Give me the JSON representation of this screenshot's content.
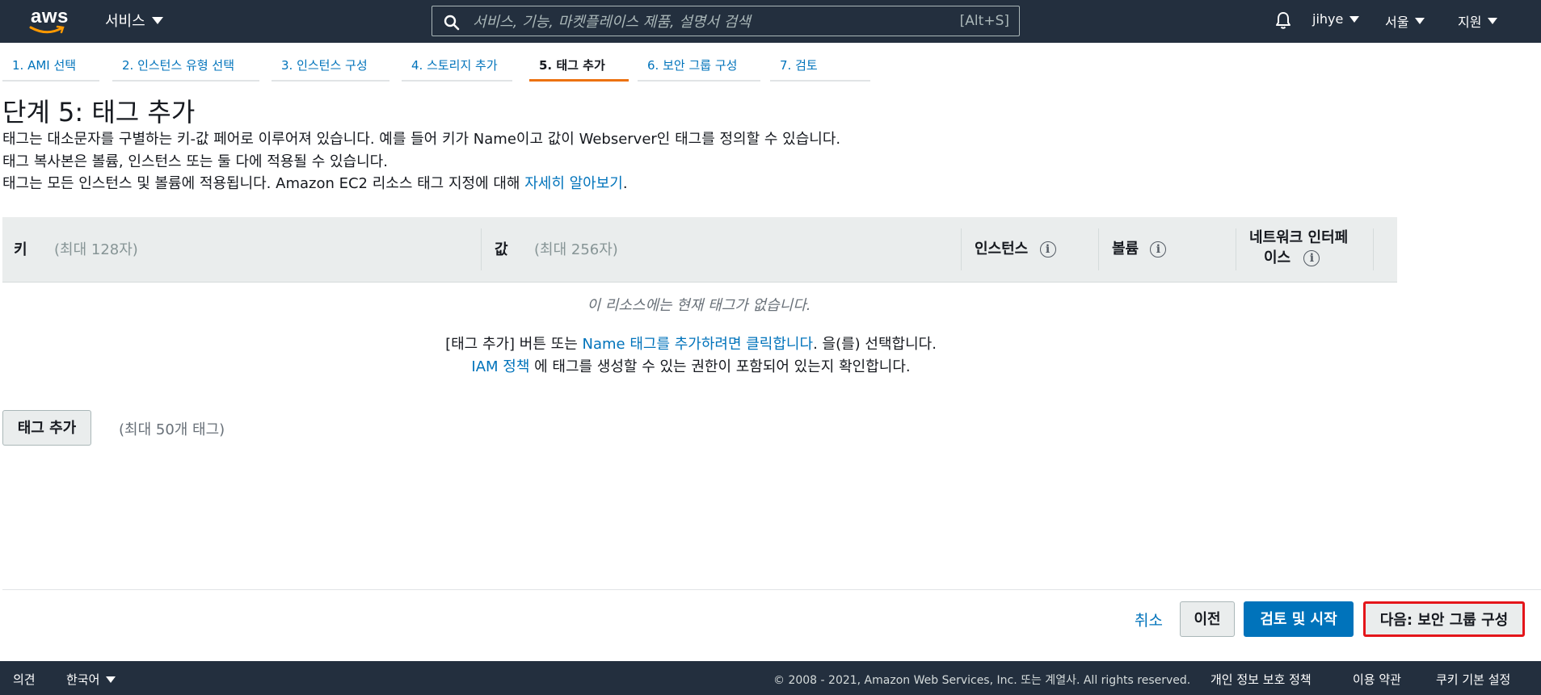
{
  "header": {
    "logo_text": "aws",
    "services_label": "서비스",
    "search_placeholder": "서비스, 기능, 마켓플레이스 제품, 설명서 검색",
    "search_shortcut": "[Alt+S]",
    "user_label": "jihye",
    "region_label": "서울",
    "support_label": "지원"
  },
  "wizard": {
    "steps": [
      {
        "label": "1. AMI 선택"
      },
      {
        "label": "2. 인스턴스 유형 선택"
      },
      {
        "label": "3. 인스턴스 구성"
      },
      {
        "label": "4. 스토리지 추가"
      },
      {
        "label": "5. 태그 추가"
      },
      {
        "label": "6. 보안 그룹 구성"
      },
      {
        "label": "7. 검토"
      }
    ],
    "active_step": 5
  },
  "page": {
    "title": "단계 5: 태그 추가",
    "desc1": "태그는 대소문자를 구별하는 키-값 페어로 이루어져 있습니다. 예를 들어 키가 Name이고 값이 Webserver인 태그를 정의할 수 있습니다.",
    "desc2": "태그 복사본은 볼륨, 인스턴스 또는 둘 다에 적용될 수 있습니다.",
    "desc3": "태그는 모든 인스턴스 및 볼륨에 적용됩니다. Amazon EC2 리소스 태그 지정에 대해 ",
    "learn_more_link": "자세히 알아보기",
    "desc3_end": "."
  },
  "table": {
    "key_header": "키",
    "key_hint": "(최대 128자)",
    "value_header": "값",
    "value_hint": "(최대 256자)",
    "instances_header": "인스턴스",
    "volumes_header": "볼륨",
    "network_header_line1": "네트워크 인터페",
    "network_header_line2": "이스",
    "info_glyph": "i",
    "empty_message": "이 리소스에는 현재 태그가 없습니다.",
    "msg1_prefix": "[태그 추가] 버튼 또는 ",
    "msg1_link": "Name 태그를 추가하려면 클릭합니다",
    "msg1_suffix": ". 을(를) 선택합니다.",
    "msg2_link": "IAM 정책",
    "msg2_suffix": " 에 태그를 생성할 수 있는 권한이 포함되어 있는지 확인합니다."
  },
  "actions": {
    "add_tag_label": "태그 추가",
    "max_tags_label": "(최대 50개 태그)",
    "cancel_label": "취소",
    "previous_label": "이전",
    "review_launch_label": "검토 및 시작",
    "next_label": "다음: 보안 그룹 구성"
  },
  "footer": {
    "feedback_label": "의견",
    "language_label": "한국어",
    "copyright": "© 2008 - 2021, Amazon Web Services, Inc. 또는 계열사. All rights reserved.",
    "privacy_label": "개인 정보 보호 정책",
    "terms_label": "이용 약관",
    "cookie_label": "쿠키 기본 설정"
  },
  "colors": {
    "nav_bg": "#232f3e",
    "link": "#0073bb",
    "active_tab_underline": "#ec7211",
    "highlight_border": "#e4151a"
  },
  "icons": [
    "search-icon",
    "bell-icon",
    "info-icon",
    "caret-down-icon",
    "aws-smile-icon"
  ]
}
